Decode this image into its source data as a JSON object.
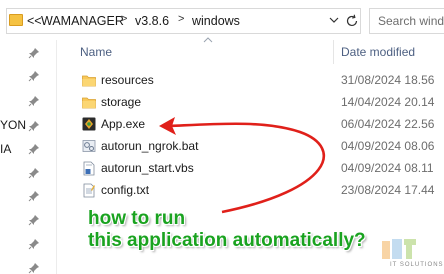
{
  "address_bar": {
    "overflow": "<<",
    "crumbs": [
      "WAMANAGER",
      "v3.8.6",
      "windows"
    ]
  },
  "search": {
    "placeholder": "Search wind"
  },
  "nav": {
    "items": [
      "",
      "",
      "",
      "YON",
      "IA",
      "",
      "",
      "",
      "",
      ""
    ]
  },
  "columns": {
    "name": "Name",
    "date_modified": "Date modified"
  },
  "files": [
    {
      "name": "resources",
      "date": "31/08/2024 18.56",
      "icon": "folder-icon"
    },
    {
      "name": "storage",
      "date": "14/04/2024 20.14",
      "icon": "folder-icon"
    },
    {
      "name": "App.exe",
      "date": "06/04/2024 22.56",
      "icon": "exe-app-icon"
    },
    {
      "name": "autorun_ngrok.bat",
      "date": "04/09/2024 08.06",
      "icon": "batch-file-icon"
    },
    {
      "name": "autorun_start.vbs",
      "date": "04/09/2024 08.11",
      "icon": "vbs-script-icon"
    },
    {
      "name": "config.txt",
      "date": "23/08/2024 17.44",
      "icon": "text-file-icon"
    }
  ],
  "annotation": {
    "line1": "how to run",
    "line2": "this application automatically?",
    "text_color": "#1aa320",
    "arrow_color": "#e0201a"
  },
  "watermark": {
    "text": "IT SOLUTIONS"
  }
}
